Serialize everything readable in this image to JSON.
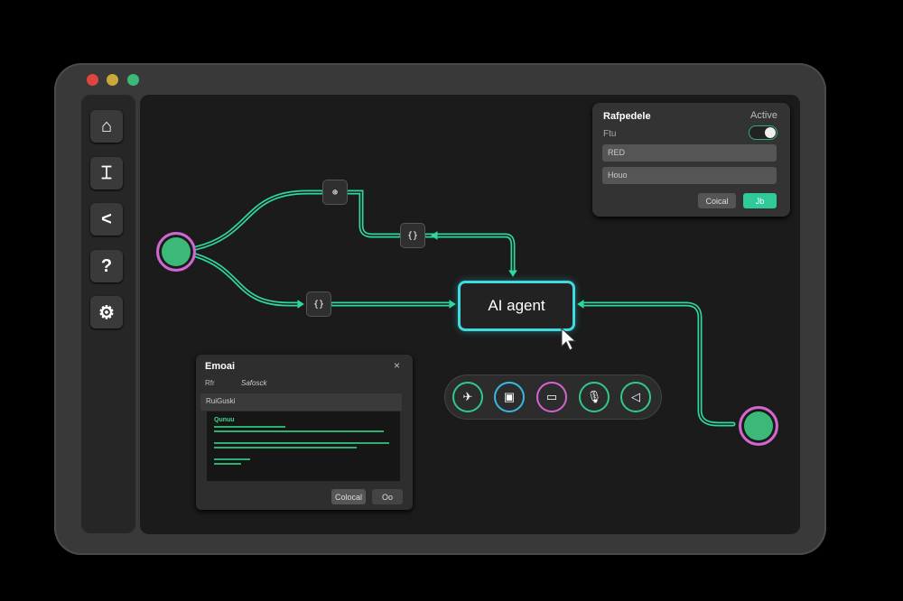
{
  "window": {
    "traffic_lights": [
      "#e0443e",
      "#c9a93a",
      "#3cb878"
    ]
  },
  "sidebar": {
    "items": [
      {
        "icon": "home-icon",
        "glyph": "⌂"
      },
      {
        "icon": "workflow-icon",
        "glyph": "⌶"
      },
      {
        "icon": "share-icon",
        "glyph": "<"
      },
      {
        "icon": "help-icon",
        "glyph": "?"
      },
      {
        "icon": "gear-icon",
        "glyph": "⚙"
      }
    ]
  },
  "nodes": {
    "n1": "⊕",
    "n2": "{}",
    "n3": "{}",
    "agent": "AI agent"
  },
  "settings_panel": {
    "title": "Rafpedele",
    "status": "Active",
    "label": "Ftu",
    "field1": "RED",
    "field2": "Houo",
    "cancel": "Coical",
    "confirm": "Jb",
    "toggle_on": true
  },
  "email_dialog": {
    "title": "Emoai",
    "close": "×",
    "from_label": "Rfr",
    "from_value": "Safosck",
    "subject": "RuiGuski",
    "body_heading": "Qunuu",
    "cancel": "Colocal",
    "ok": "Oo"
  },
  "toolbar": {
    "tools": [
      {
        "icon": "pin-icon",
        "glyph": "✈",
        "ring": "#2fc98a"
      },
      {
        "icon": "image-icon",
        "glyph": "▣",
        "ring": "#3ab8e0"
      },
      {
        "icon": "toggle-icon",
        "glyph": "▭",
        "ring": "#d465d4"
      },
      {
        "icon": "microphone-icon",
        "glyph": "🎙",
        "ring": "#2fc98a"
      },
      {
        "icon": "send-icon",
        "glyph": "◁",
        "ring": "#2fc98a"
      }
    ]
  },
  "colors": {
    "accent": "#2ed6a0",
    "agent_border": "#3fd9e0",
    "node_ring": "#d465d4"
  }
}
